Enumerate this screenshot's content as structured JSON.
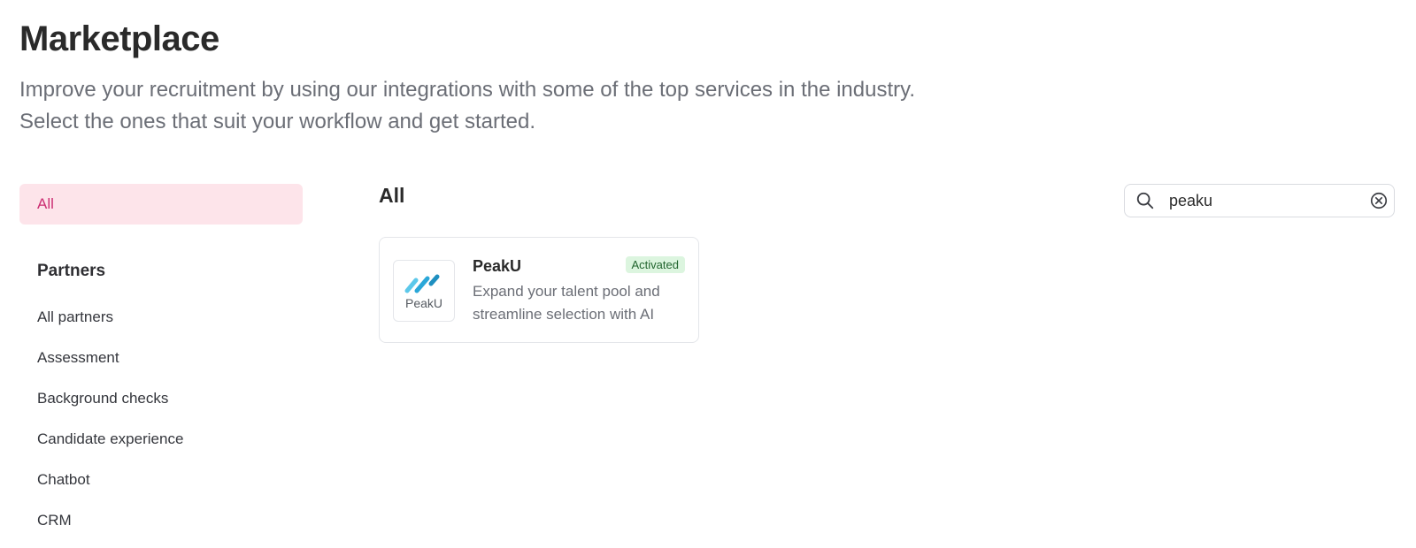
{
  "header": {
    "title": "Marketplace",
    "subtitle_line1": "Improve your recruitment by using our integrations with some of the top services in the industry.",
    "subtitle_line2": "Select the ones that suit your workflow and get started."
  },
  "sidebar": {
    "all_label": "All",
    "section_title": "Partners",
    "items": [
      {
        "label": "All partners"
      },
      {
        "label": "Assessment"
      },
      {
        "label": "Background checks"
      },
      {
        "label": "Candidate experience"
      },
      {
        "label": "Chatbot"
      },
      {
        "label": "CRM"
      }
    ]
  },
  "main": {
    "title": "All",
    "search": {
      "value": "peaku",
      "icon": "search-icon",
      "clear_icon": "clear-circle-icon"
    },
    "cards": [
      {
        "name": "PeakU",
        "logo_text": "PeakU",
        "badge": "Activated",
        "description": "Expand your talent pool and streamline selection with AI"
      }
    ]
  },
  "colors": {
    "accent": "#cc2f73",
    "accent_bg": "#fde4ea",
    "badge_bg": "#dcf5df",
    "badge_text": "#22652f",
    "logo_blue": "#2aa7d8"
  }
}
